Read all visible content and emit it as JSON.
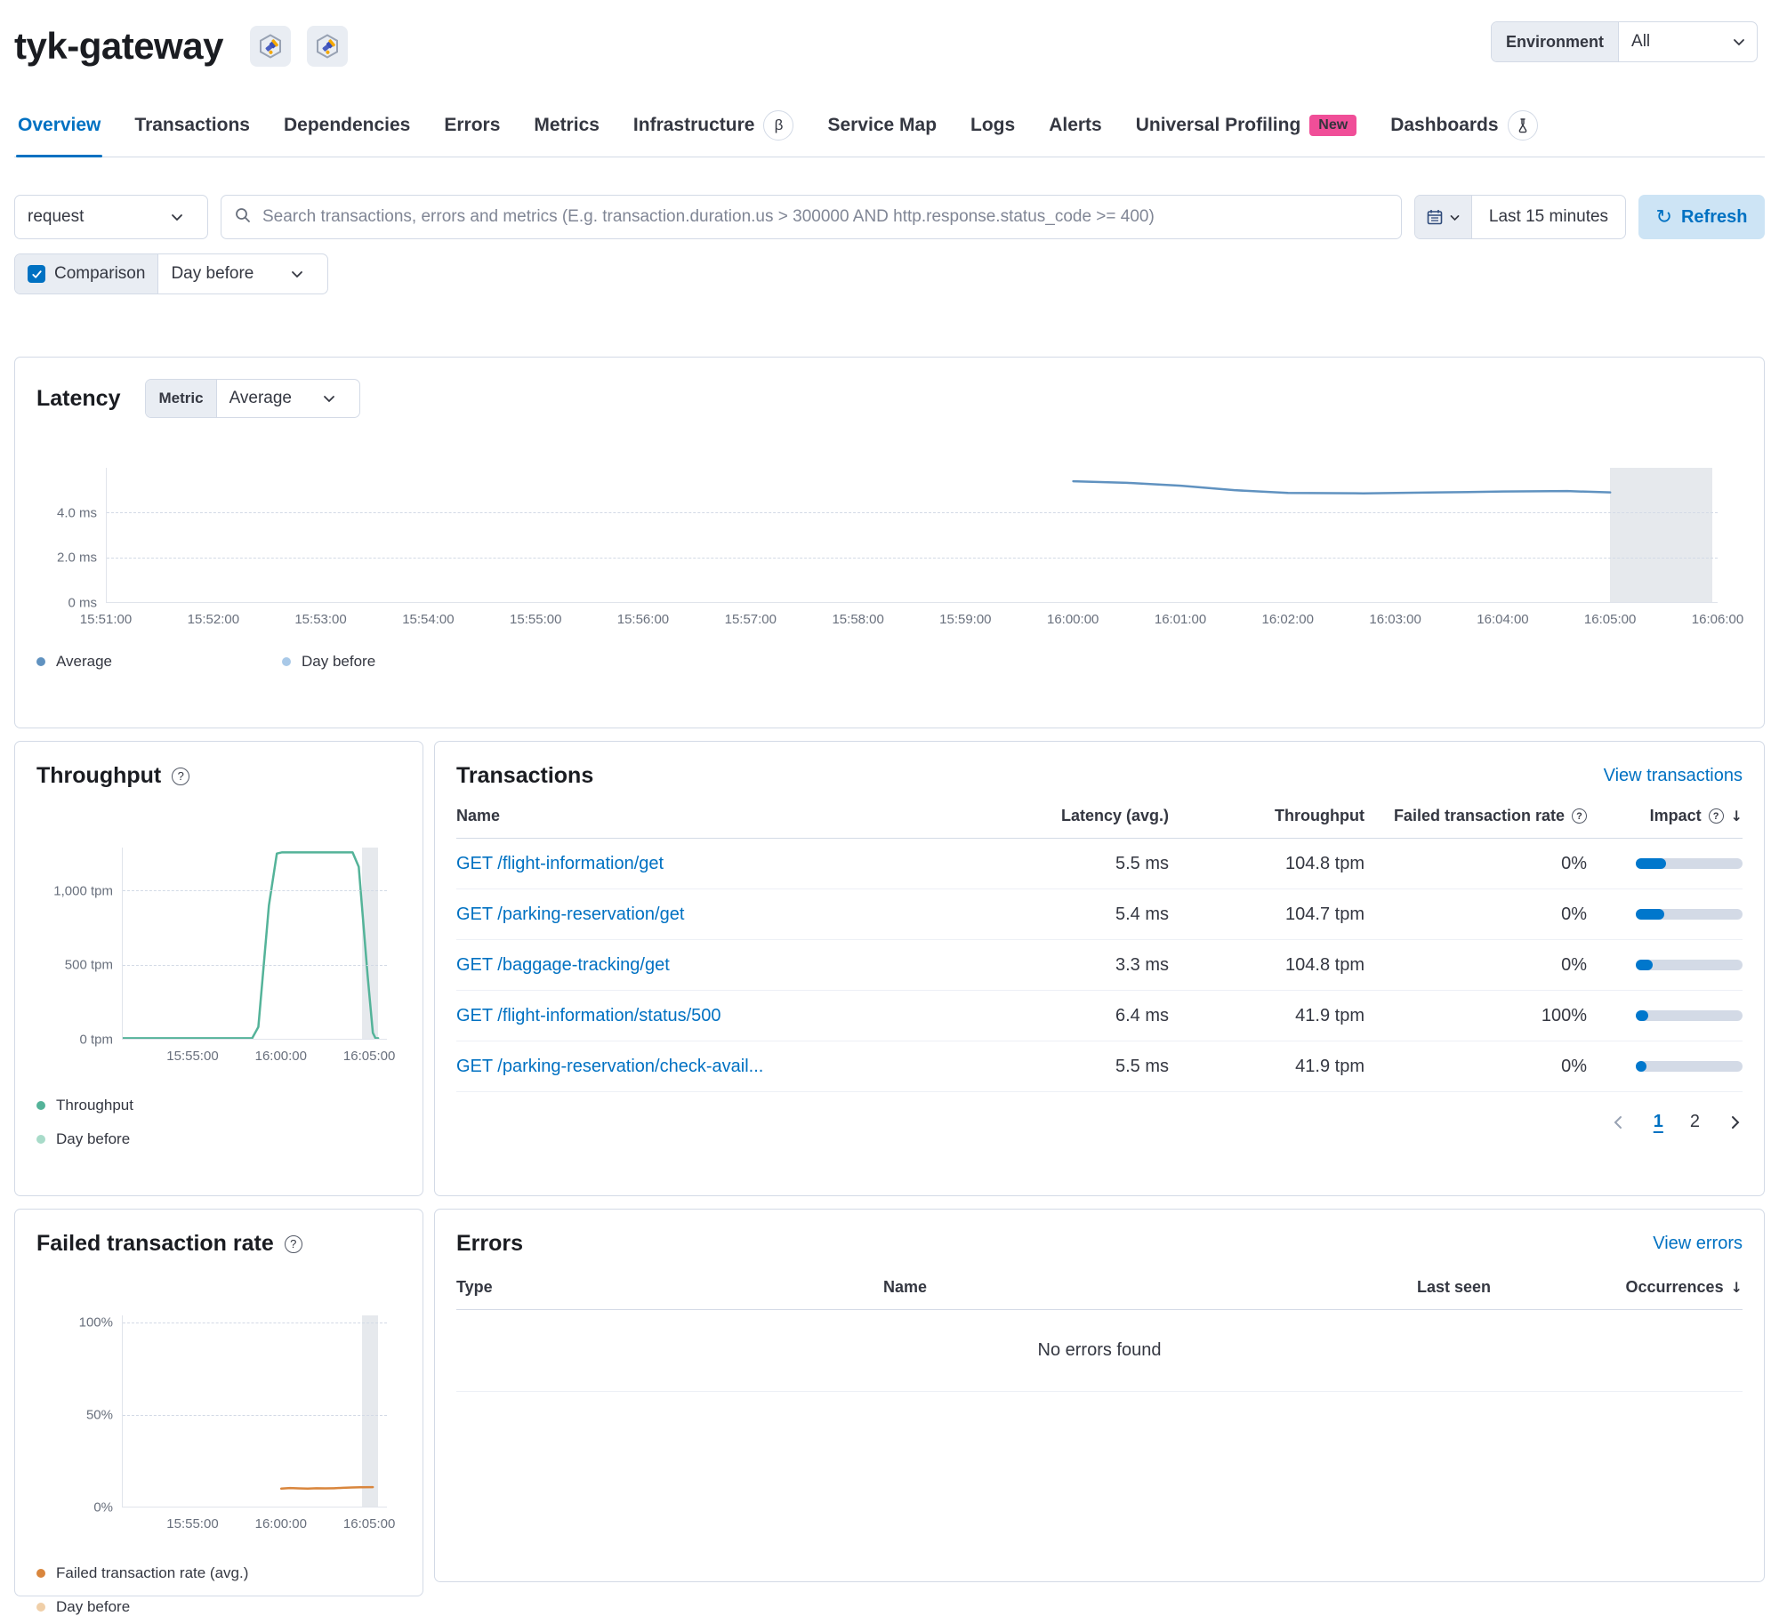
{
  "header": {
    "title": "tyk-gateway",
    "environment_label": "Environment",
    "environment_value": "All"
  },
  "nav": {
    "overview": "Overview",
    "transactions": "Transactions",
    "dependencies": "Dependencies",
    "errors": "Errors",
    "metrics": "Metrics",
    "infrastructure": "Infrastructure",
    "infrastructure_badge": "β",
    "service_map": "Service Map",
    "logs": "Logs",
    "alerts": "Alerts",
    "universal_profiling": "Universal Profiling",
    "universal_profiling_badge": "New",
    "dashboards": "Dashboards"
  },
  "filters": {
    "kuery_type": "request",
    "search_placeholder": "Search transactions, errors and metrics (E.g. transaction.duration.us > 300000 AND http.response.status_code >= 400)",
    "time_range": "Last 15 minutes",
    "refresh_label": "Refresh",
    "comparison_label": "Comparison",
    "comparison_checked": true,
    "comparison_value": "Day before"
  },
  "icons": {
    "help_glyph": "?",
    "sort_desc_glyph": "↓",
    "refresh_glyph": "↻"
  },
  "latency_panel": {
    "title": "Latency",
    "metric_label": "Metric",
    "metric_value": "Average"
  },
  "chart_data": [
    {
      "id": "latency",
      "type": "line",
      "title": "Latency",
      "ylabel": "ms",
      "ylim": [
        0,
        6
      ],
      "xlim_minutes": [
        0,
        15
      ],
      "y_ticks": [
        {
          "value": 4,
          "label": "4.0 ms"
        },
        {
          "value": 2,
          "label": "2.0 ms"
        },
        {
          "value": 0,
          "label": "0 ms"
        }
      ],
      "x_ticks": [
        {
          "minute": 0,
          "label": "15:51:00"
        },
        {
          "minute": 1,
          "label": "15:52:00"
        },
        {
          "minute": 2,
          "label": "15:53:00"
        },
        {
          "minute": 3,
          "label": "15:54:00"
        },
        {
          "minute": 4,
          "label": "15:55:00"
        },
        {
          "minute": 5,
          "label": "15:56:00"
        },
        {
          "minute": 6,
          "label": "15:57:00"
        },
        {
          "minute": 7,
          "label": "15:58:00"
        },
        {
          "minute": 8,
          "label": "15:59:00"
        },
        {
          "minute": 9,
          "label": "16:00:00"
        },
        {
          "minute": 10,
          "label": "16:01:00"
        },
        {
          "minute": 11,
          "label": "16:02:00"
        },
        {
          "minute": 12,
          "label": "16:03:00"
        },
        {
          "minute": 13,
          "label": "16:04:00"
        },
        {
          "minute": 14,
          "label": "16:05:00"
        },
        {
          "minute": 15,
          "label": "16:06:00"
        }
      ],
      "series": [
        {
          "name": "Average",
          "color": "#6092c0",
          "unit": "ms",
          "points": [
            [
              9,
              5.4
            ],
            [
              9.5,
              5.33
            ],
            [
              10,
              5.2
            ],
            [
              10.5,
              5.0
            ],
            [
              11,
              4.88
            ],
            [
              11.7,
              4.86
            ],
            [
              12.4,
              4.9
            ],
            [
              13,
              4.94
            ],
            [
              13.6,
              4.96
            ],
            [
              14,
              4.9
            ]
          ]
        }
      ],
      "comparison_band_minutes": [
        14,
        14.95
      ],
      "legend": [
        {
          "label": "Average",
          "color": "#6092c0"
        },
        {
          "label": "Day before",
          "color": "#a9c9e8"
        }
      ]
    },
    {
      "id": "throughput",
      "type": "line",
      "title": "Throughput",
      "ylabel": "tpm",
      "ylim": [
        0,
        1290
      ],
      "xlim_minutes": [
        0,
        15
      ],
      "y_ticks": [
        {
          "value": 1000,
          "label": "1,000 tpm"
        },
        {
          "value": 500,
          "label": "500 tpm"
        },
        {
          "value": 0,
          "label": "0 tpm"
        }
      ],
      "x_ticks": [
        {
          "minute": 4,
          "label": "15:55:00"
        },
        {
          "minute": 9,
          "label": "16:00:00"
        },
        {
          "minute": 14,
          "label": "16:05:00"
        }
      ],
      "series": [
        {
          "name": "Throughput",
          "color": "#54b399",
          "unit": "tpm",
          "points": [
            [
              0,
              4
            ],
            [
              7.35,
              4
            ],
            [
              7.7,
              80
            ],
            [
              8.3,
              900
            ],
            [
              8.75,
              1250
            ],
            [
              9.05,
              1258
            ],
            [
              13.05,
              1258
            ],
            [
              13.4,
              1160
            ],
            [
              13.9,
              430
            ],
            [
              14.2,
              40
            ],
            [
              14.35,
              4
            ],
            [
              14.5,
              4
            ]
          ]
        }
      ],
      "comparison_band_minutes": [
        13.6,
        14.5
      ],
      "legend": [
        {
          "label": "Throughput",
          "color": "#54b399"
        },
        {
          "label": "Day before",
          "color": "#a8dbc9"
        }
      ]
    },
    {
      "id": "failed-rate",
      "type": "line",
      "title": "Failed transaction rate",
      "ylabel": "%",
      "ylim": [
        0,
        104
      ],
      "xlim_minutes": [
        0,
        15
      ],
      "y_ticks": [
        {
          "value": 100,
          "label": "100%"
        },
        {
          "value": 50,
          "label": "50%"
        },
        {
          "value": 0,
          "label": "0%"
        }
      ],
      "x_ticks": [
        {
          "minute": 4,
          "label": "15:55:00"
        },
        {
          "minute": 9,
          "label": "16:00:00"
        },
        {
          "minute": 14,
          "label": "16:05:00"
        }
      ],
      "series": [
        {
          "name": "Failed transaction rate (avg.)",
          "color": "#d9863d",
          "unit": "%",
          "points": [
            [
              9,
              9.8
            ],
            [
              9.5,
              10.1
            ],
            [
              10,
              9.9
            ],
            [
              10.5,
              9.8
            ],
            [
              11,
              10.0
            ],
            [
              11.5,
              9.9
            ],
            [
              12,
              10.0
            ],
            [
              12.5,
              10.2
            ],
            [
              13,
              10.4
            ],
            [
              13.5,
              10.5
            ],
            [
              14.2,
              10.6
            ]
          ]
        }
      ],
      "comparison_band_minutes": [
        13.6,
        14.5
      ],
      "legend": [
        {
          "label": "Failed transaction rate (avg.)",
          "color": "#d9863d"
        },
        {
          "label": "Day before",
          "color": "#f0cfa8"
        }
      ]
    }
  ],
  "throughput_panel": {
    "title": "Throughput"
  },
  "ftr_panel": {
    "title": "Failed transaction rate"
  },
  "transactions_panel": {
    "title": "Transactions",
    "view_link": "View transactions",
    "columns": {
      "name": "Name",
      "latency": "Latency (avg.)",
      "throughput": "Throughput",
      "failed_rate": "Failed transaction rate",
      "impact": "Impact"
    },
    "rows": [
      {
        "name": "GET /flight-information/get",
        "latency": "5.5 ms",
        "throughput": "104.8 tpm",
        "failed_rate": "0%",
        "impact_pct": 28
      },
      {
        "name": "GET /parking-reservation/get",
        "latency": "5.4 ms",
        "throughput": "104.7 tpm",
        "failed_rate": "0%",
        "impact_pct": 27
      },
      {
        "name": "GET /baggage-tracking/get",
        "latency": "3.3 ms",
        "throughput": "104.8 tpm",
        "failed_rate": "0%",
        "impact_pct": 16
      },
      {
        "name": "GET /flight-information/status/500",
        "latency": "6.4 ms",
        "throughput": "41.9 tpm",
        "failed_rate": "100%",
        "impact_pct": 12
      },
      {
        "name": "GET /parking-reservation/check-avail...",
        "latency": "5.5 ms",
        "throughput": "41.9 tpm",
        "failed_rate": "0%",
        "impact_pct": 10
      }
    ],
    "pagination": {
      "page_1": "1",
      "page_2": "2",
      "active": "1"
    }
  },
  "errors_panel": {
    "title": "Errors",
    "view_link": "View errors",
    "columns": {
      "type": "Type",
      "name": "Name",
      "last_seen": "Last seen",
      "occurrences": "Occurrences"
    },
    "empty_message": "No errors found"
  }
}
